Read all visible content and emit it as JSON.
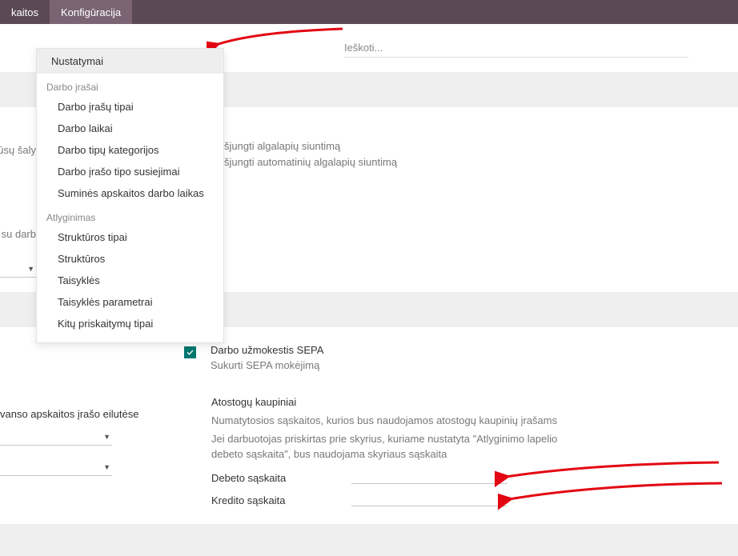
{
  "topnav": {
    "tab_left": "kaitos",
    "tab_active": "Konfigūracija"
  },
  "dropdown": {
    "main": "Nustatymai",
    "section1": "Darbo įrašai",
    "s1_items": [
      "Darbo įrašų tipai",
      "Darbo laikai",
      "Darbo tipų kategorijos",
      "Darbo įrašo tipo susiejimai",
      "Suminės apskaitos darbo laikas"
    ],
    "section2": "Atlyginimas",
    "s2_items": [
      "Struktūros tipai",
      "Struktūros",
      "Taisyklės",
      "Taisyklės parametrai",
      "Kitų priskaitymų tipai"
    ]
  },
  "search": {
    "placeholder": "Ieškoti..."
  },
  "fragments": {
    "left1": "ūsų šaly",
    "left2": "su darb",
    "right1": "šjungti algalapių siuntimą",
    "right2": "šjungti automatinių algalapių siuntimą",
    "avanso": "vanso apskaitos įrašo eilutėse"
  },
  "sepa": {
    "title": "Darbo užmokestis SEPA",
    "sub": "Sukurti SEPA mokėjimą"
  },
  "vac": {
    "title": "Atostogų kaupiniai",
    "desc1": "Numatytosios sąskaitos, kurios bus naudojamos atostogų kaupinių įrašams",
    "desc2": "Jei darbuotojas priskirtas prie skyrius, kuriame nustatyta \"Atlyginimo lapelio debeto sąskaita\", bus naudojama skyriaus sąskaita",
    "debit_label": "Debeto sąskaita",
    "credit_label": "Kredito sąskaita"
  },
  "colors": {
    "accent": "#00776f",
    "arrow": "#e30613"
  }
}
